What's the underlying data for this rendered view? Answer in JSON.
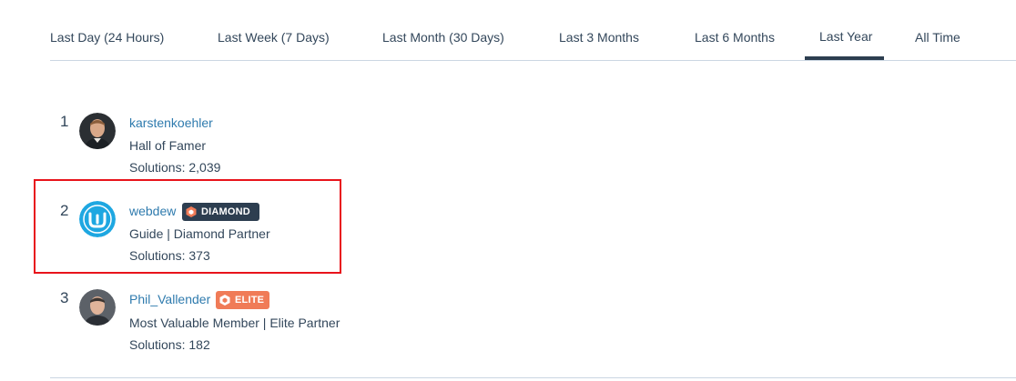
{
  "tabs": [
    {
      "label": "Last Day (24 Hours)",
      "active": false
    },
    {
      "label": "Last Week (7 Days)",
      "active": false
    },
    {
      "label": "Last Month (30 Days)",
      "active": false
    },
    {
      "label": "Last 3 Months",
      "active": false
    },
    {
      "label": "Last 6 Months",
      "active": false
    },
    {
      "label": "Last Year",
      "active": true
    },
    {
      "label": "All Time",
      "active": false
    }
  ],
  "leaderboard": [
    {
      "rank": "1",
      "username": "karstenkoehler",
      "title": "Hall of Famer",
      "solutions": "Solutions: 2,039",
      "badge": null
    },
    {
      "rank": "2",
      "username": "webdew",
      "title": "Guide | Diamond Partner",
      "solutions": "Solutions: 373",
      "badge": "DIAMOND",
      "highlighted": true
    },
    {
      "rank": "3",
      "username": "Phil_Vallender",
      "title": "Most Valuable Member | Elite Partner",
      "solutions": "Solutions: 182",
      "badge": "ELITE"
    }
  ],
  "colors": {
    "link": "#2f7bae",
    "text": "#33475b",
    "diamond_badge": "#2d3e50",
    "elite_badge": "#f07b57",
    "highlight_border": "#e8131b",
    "webdew_brand": "#1ea7e1"
  }
}
